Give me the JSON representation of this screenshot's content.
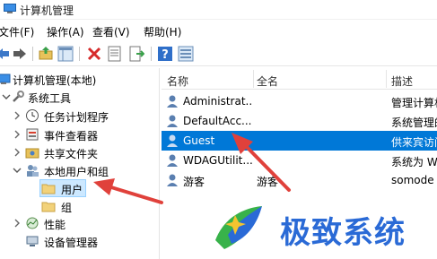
{
  "window": {
    "title": "计算机管理"
  },
  "menu": {
    "items": [
      "文件(F)",
      "操作(A)",
      "查看(V)",
      "帮助(H)"
    ]
  },
  "tree": {
    "root": "计算机管理(本地)",
    "system_tools": "系统工具",
    "task_scheduler": "任务计划程序",
    "event_viewer": "事件查看器",
    "shared_folders": "共享文件夹",
    "local_users_groups": "本地用户和组",
    "users": "用户",
    "groups": "组",
    "performance": "性能",
    "device_manager": "设备管理器"
  },
  "list": {
    "headers": {
      "name": "名称",
      "fullname": "全名",
      "description": "描述"
    },
    "rows": [
      {
        "name": "Administrat...",
        "fullname": "",
        "description": "管理计算机",
        "selected": false
      },
      {
        "name": "DefaultAcc...",
        "fullname": "",
        "description": "系统管理的",
        "selected": false
      },
      {
        "name": "Guest",
        "fullname": "",
        "description": "供来宾访问",
        "selected": true
      },
      {
        "name": "WDAGUtilit...",
        "fullname": "",
        "description": "系统为 W",
        "selected": false
      },
      {
        "name": "游客",
        "fullname": "游客",
        "description": "somode",
        "selected": false
      }
    ]
  },
  "watermark": {
    "text": "极致系统"
  },
  "colors": {
    "selection": "#0078d7",
    "arrow": "#e0413b",
    "watermark": "#2a6ad6"
  }
}
